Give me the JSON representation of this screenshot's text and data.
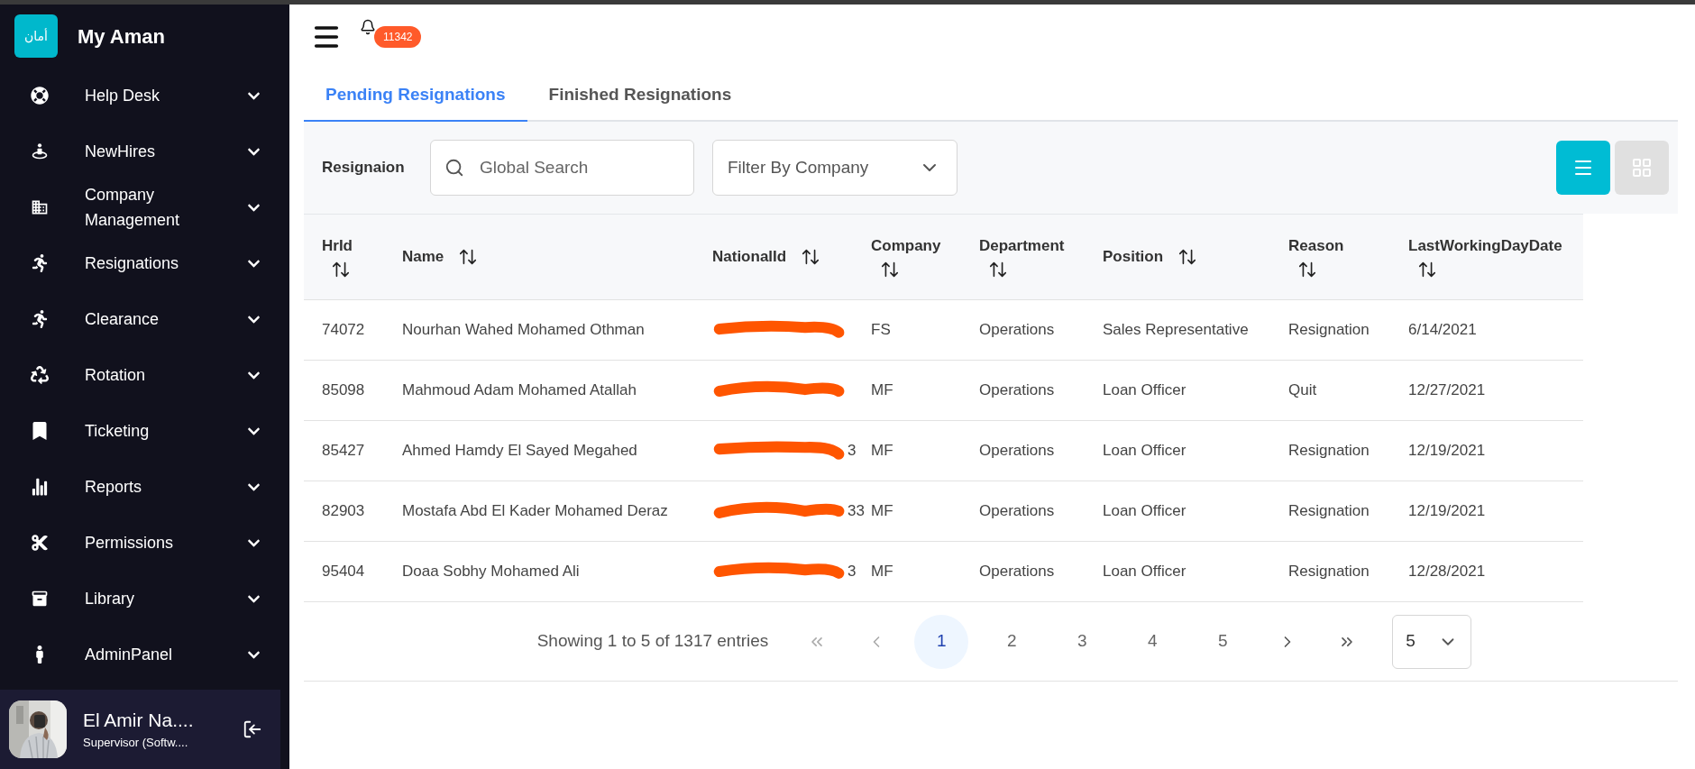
{
  "sidebar": {
    "logo_text": "أمان",
    "title": "My Aman",
    "items": [
      {
        "kind": "help",
        "label": "Help Desk",
        "expanded": false
      },
      {
        "kind": "newhires",
        "label": "NewHires",
        "expanded": false
      },
      {
        "kind": "company",
        "label": "Company Management",
        "expanded": false
      },
      {
        "kind": "run",
        "label": "Resignations",
        "expanded": false
      },
      {
        "kind": "run",
        "label": "Clearance",
        "expanded": false
      },
      {
        "kind": "recycle",
        "label": "Rotation",
        "expanded": false
      },
      {
        "kind": "ticket",
        "label": "Ticketing",
        "expanded": false
      },
      {
        "kind": "chart",
        "label": "Reports",
        "expanded": false
      },
      {
        "kind": "scissors",
        "label": "Permissions",
        "expanded": false
      },
      {
        "kind": "library",
        "label": "Library",
        "expanded": false
      },
      {
        "kind": "admin",
        "label": "AdminPanel",
        "expanded": false
      }
    ],
    "user": {
      "name": "El Amir Na....",
      "role": "Supervisor (Softw...."
    }
  },
  "header": {
    "notification_count": "11342"
  },
  "tabs": [
    {
      "label": "Pending Resignations",
      "selected": true
    },
    {
      "label": "Finished Resignations",
      "selected": false
    }
  ],
  "toolbar": {
    "label": "Resignaion",
    "search": {
      "placeholder": "Global Search"
    },
    "company_filter": {
      "placeholder": "Filter By Company"
    },
    "view_toggle": [
      {
        "kind": "list",
        "selected": true
      },
      {
        "kind": "grid",
        "selected": false
      }
    ]
  },
  "table": {
    "columns": [
      "HrId",
      "Name",
      "NationalId",
      "Company",
      "Department",
      "Position",
      "Reason",
      "LastWorkingDayDate"
    ],
    "rows": [
      {
        "hrid": "74072",
        "name": "Nourhan Wahed Mohamed Othman",
        "company": "FS",
        "department": "Operations",
        "position": "Sales Representative",
        "reason": "Resignation",
        "last_working_day": "6/14/2021"
      },
      {
        "hrid": "85098",
        "name": "Mahmoud Adam Mohamed Atallah",
        "company": "MF",
        "department": "Operations",
        "position": "Loan Officer",
        "reason": "Quit",
        "last_working_day": "12/27/2021"
      },
      {
        "hrid": "85427",
        "name": "Ahmed Hamdy El Sayed Megahed",
        "national_id_visible": "3",
        "company": "MF",
        "department": "Operations",
        "position": "Loan Officer",
        "reason": "Resignation",
        "last_working_day": "12/19/2021"
      },
      {
        "hrid": "82903",
        "name": "Mostafa Abd El Kader Mohamed Deraz",
        "national_id_visible": "33",
        "company": "MF",
        "department": "Operations",
        "position": "Loan Officer",
        "reason": "Resignation",
        "last_working_day": "12/19/2021"
      },
      {
        "hrid": "95404",
        "name": "Doaa Sobhy Mohamed Ali",
        "national_id_visible": "3",
        "company": "MF",
        "department": "Operations",
        "position": "Loan Officer",
        "reason": "Resignation",
        "last_working_day": "12/28/2021"
      }
    ]
  },
  "pagination": {
    "summary": "Showing 1 to 5 of 1317 entries",
    "pages": [
      {
        "label": "1",
        "selected": true
      },
      {
        "label": "2",
        "selected": false
      },
      {
        "label": "3",
        "selected": false
      },
      {
        "label": "4",
        "selected": false
      },
      {
        "label": "5",
        "selected": false
      }
    ],
    "page_size": "5"
  }
}
